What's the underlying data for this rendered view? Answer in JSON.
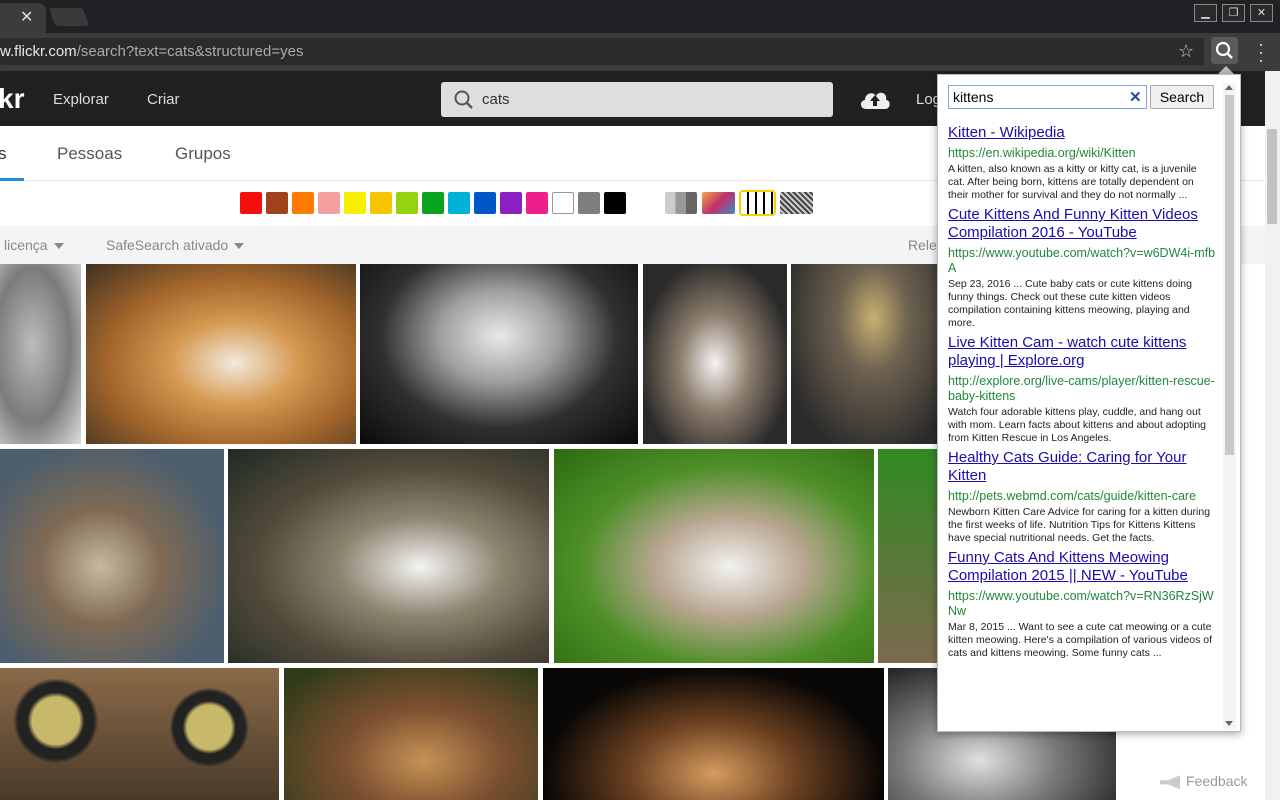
{
  "browser": {
    "url_host": "w.flickr.com",
    "url_path": "/search?text=cats&structured=yes",
    "tab_close": "✕",
    "window_buttons": [
      "▁",
      "❐",
      "✕"
    ]
  },
  "header": {
    "logo": "kr",
    "nav": [
      "Explorar",
      "Criar"
    ],
    "search_value": "cats",
    "login": "Log"
  },
  "subnav": {
    "tabs": [
      "s",
      "Pessoas",
      "Grupos"
    ]
  },
  "colors": [
    "#f40e0e",
    "#a0421b",
    "#ff7b00",
    "#f5a0a0",
    "#f7ee00",
    "#f6c500",
    "#94d30f",
    "#0aa31e",
    "#00b3d6",
    "#0057c8",
    "#8b1fc2",
    "#f01e8c",
    "#ffffff",
    "#7e7e7e",
    "#000000"
  ],
  "filters": {
    "license": "licença",
    "safesearch": "SafeSearch ativado",
    "sort": "Rele"
  },
  "feedback": "Feedback",
  "popup": {
    "query": "kittens",
    "clear": "✕",
    "search_button": "Search",
    "results": [
      {
        "title": "Kitten - Wikipedia",
        "url": "https://en.wikipedia.org/wiki/Kitten",
        "snippet": "A kitten, also known as a kitty or kitty cat, is a juvenile cat. After being born, kittens are totally dependent on their mother for survival and they do not normally ..."
      },
      {
        "title": "Cute Kittens And Funny Kitten Videos Compilation 2016 - YouTube",
        "url": "https://www.youtube.com/watch?v=w6DW4i-mfbA",
        "snippet": "Sep 23, 2016 ... Cute baby cats or cute kittens doing funny things. Check out these cute kitten videos compilation containing kittens meowing, playing and more."
      },
      {
        "title": "Live Kitten Cam - watch cute kittens playing | Explore.org",
        "url": "http://explore.org/live-cams/player/kitten-rescue-baby-kittens",
        "snippet": "Watch four adorable kittens play, cuddle, and hang out with mom. Learn facts about kittens and about adopting from Kitten Rescue in Los Angeles."
      },
      {
        "title": "Healthy Cats Guide: Caring for Your Kitten",
        "url": "http://pets.webmd.com/cats/guide/kitten-care",
        "snippet": "Newborn Kitten Care Advice for caring for a kitten during the first weeks of life. Nutrition Tips for Kittens Kittens have special nutritional needs. Get the facts."
      },
      {
        "title": "Funny Cats And Kittens Meowing Compilation 2015 || NEW - YouTube",
        "url": "https://www.youtube.com/watch?v=RN36RzSjWNw",
        "snippet": "Mar 8, 2015 ... Want to see a cute cat meowing or a cute kitten meowing. Here's a compilation of various videos of cats and kittens meowing. Some funny cats ..."
      }
    ]
  }
}
